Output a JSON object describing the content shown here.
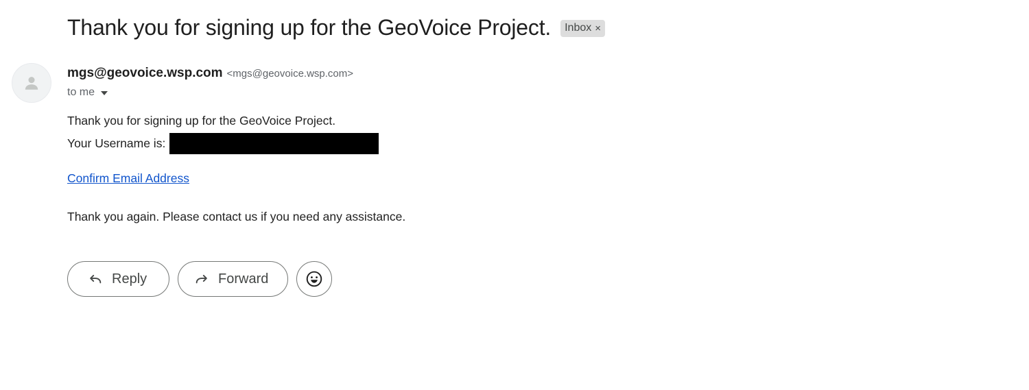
{
  "email": {
    "subject": "Thank you for signing up for the GeoVoice Project.",
    "label": "Inbox",
    "label_remove": "×",
    "sender": {
      "name": "mgs@geovoice.wsp.com",
      "email": "<mgs@geovoice.wsp.com>"
    },
    "recipient": "to me",
    "body": {
      "line1": "Thank you for signing up for the GeoVoice Project.",
      "username_label": "Your Username is:",
      "link_text": "Confirm Email Address",
      "closing": "Thank you again. Please contact us if you need any assistance."
    }
  },
  "actions": {
    "reply_label": "Reply",
    "forward_label": "Forward"
  },
  "icons": {
    "avatar": "person-icon",
    "reply": "reply-arrow-icon",
    "forward": "forward-arrow-icon",
    "emoji": "smiley-icon",
    "details": "caret-down-icon"
  },
  "colors": {
    "link": "#1155cc",
    "chip_bg": "#dddddd",
    "redaction": "#000000"
  }
}
